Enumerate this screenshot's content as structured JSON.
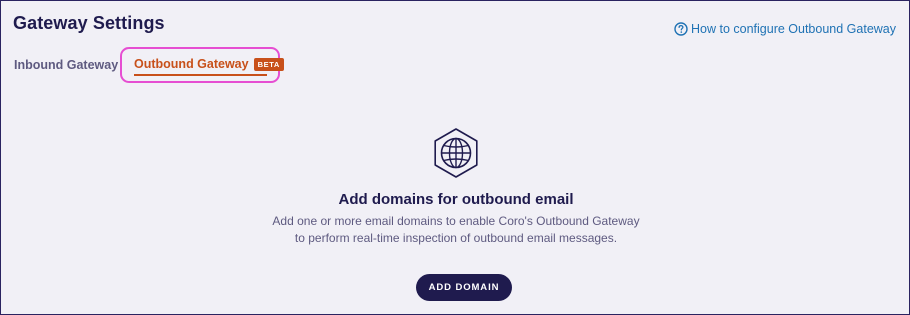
{
  "header": {
    "title": "Gateway Settings",
    "help_link": {
      "icon": "help-circle-icon",
      "label": "How to configure Outbound Gateway",
      "color": "#1f72b4"
    }
  },
  "tabs": [
    {
      "label": "Inbound Gateway",
      "active": false
    },
    {
      "label": "Outbound Gateway",
      "active": true,
      "badge": "BETA"
    }
  ],
  "empty_state": {
    "icon": "globe-hexagon-icon",
    "title": "Add domains for outbound email",
    "description_line1": "Add one or more email domains to enable Coro's Outbound Gateway",
    "description_line2": "to perform real-time inspection of outbound email messages.",
    "button_label": "ADD DOMAIN"
  },
  "colors": {
    "background": "#f1f0f6",
    "primary": "#1f1b4e",
    "accent": "#c8501a",
    "focus_ring": "#e64ed2",
    "muted_text": "#5e5a80"
  }
}
